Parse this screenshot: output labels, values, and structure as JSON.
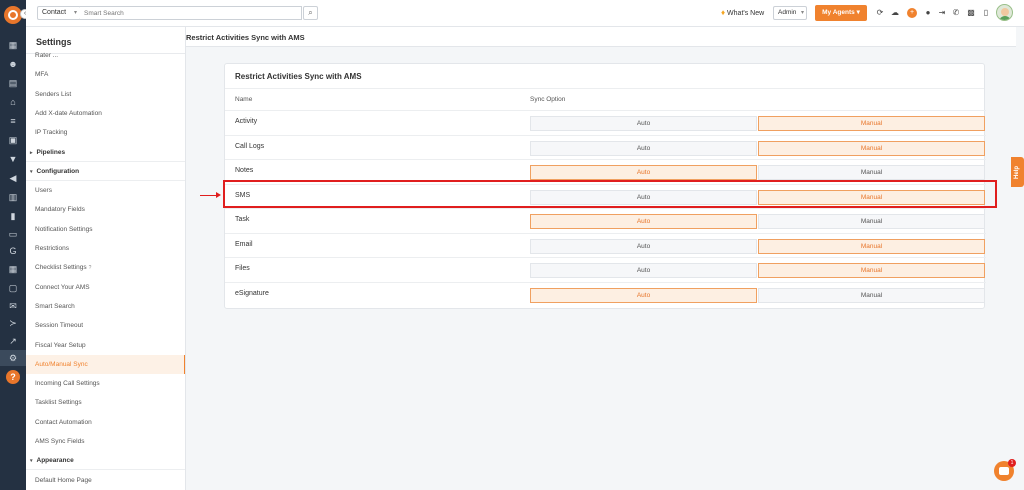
{
  "topbar": {
    "contact_select": "Contact",
    "search_placeholder": "Smart Search",
    "whats_new": "What's New",
    "admin_select": "Admin",
    "my_agents": "My Agents"
  },
  "settings": {
    "title": "Settings",
    "items": [
      {
        "label": "Rater ...",
        "type": "item"
      },
      {
        "label": "MFA",
        "type": "item"
      },
      {
        "label": "Senders List",
        "type": "item"
      },
      {
        "label": "Add X-date Automation",
        "type": "item"
      },
      {
        "label": "IP Tracking",
        "type": "item"
      },
      {
        "label": "Pipelines",
        "type": "group"
      },
      {
        "label": "Configuration",
        "type": "group"
      },
      {
        "label": "Users",
        "type": "item"
      },
      {
        "label": "Mandatory Fields",
        "type": "item"
      },
      {
        "label": "Notification Settings",
        "type": "item"
      },
      {
        "label": "Restrictions",
        "type": "item"
      },
      {
        "label": "Checklist Settings",
        "type": "item"
      },
      {
        "label": "Connect Your AMS",
        "type": "item"
      },
      {
        "label": "Smart Search",
        "type": "item"
      },
      {
        "label": "Session Timeout",
        "type": "item"
      },
      {
        "label": "Fiscal Year Setup",
        "type": "item"
      },
      {
        "label": "Auto/Manual Sync",
        "type": "item",
        "active": true
      },
      {
        "label": "Incoming Call Settings",
        "type": "item"
      },
      {
        "label": "Tasklist Settings",
        "type": "item"
      },
      {
        "label": "Contact Automation",
        "type": "item"
      },
      {
        "label": "AMS Sync Fields",
        "type": "item"
      },
      {
        "label": "Appearance",
        "type": "group"
      },
      {
        "label": "Default Home Page",
        "type": "item"
      }
    ]
  },
  "main": {
    "header": "Restrict Activities Sync with AMS",
    "card_title": "Restrict Activities Sync with AMS",
    "col_name": "Name",
    "col_sync": "Sync Option",
    "auto_label": "Auto",
    "manual_label": "Manual",
    "rows": [
      {
        "name": "Activity",
        "selected": "Manual"
      },
      {
        "name": "Call Logs",
        "selected": "Manual"
      },
      {
        "name": "Notes",
        "selected": "Auto"
      },
      {
        "name": "SMS",
        "selected": "Manual"
      },
      {
        "name": "Task",
        "selected": "Auto"
      },
      {
        "name": "Email",
        "selected": "Manual"
      },
      {
        "name": "Files",
        "selected": "Manual"
      },
      {
        "name": "eSignature",
        "selected": "Auto"
      }
    ]
  },
  "help_tab": "Help",
  "chat_badge": "1",
  "colors": {
    "accent": "#f0822e",
    "rail": "#243142",
    "highlight": "#e01e1e"
  }
}
